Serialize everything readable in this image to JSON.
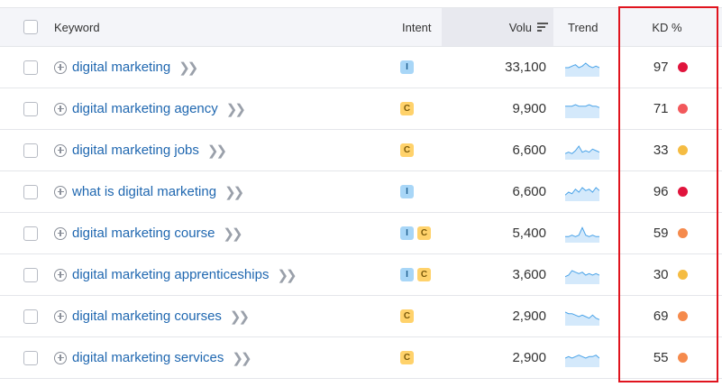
{
  "header": {
    "keyword_label": "Keyword",
    "intent_label": "Intent",
    "volume_label": "Volu",
    "trend_label": "Trend",
    "kd_label": "KD %"
  },
  "colors": {
    "kd_very_hard": "#e0143c",
    "kd_hard": "#f2585b",
    "kd_difficult": "#f58a4c",
    "kd_possible": "#f5bc42",
    "link": "#1f67b0",
    "highlight_box": "#e0141e"
  },
  "rows": [
    {
      "keyword": "digital marketing",
      "intent": [
        "I"
      ],
      "volume": "33,100",
      "kd": "97",
      "kd_color": "#e0143c",
      "trend": [
        6,
        6,
        7,
        8,
        6,
        7,
        9,
        7,
        6,
        7,
        6
      ]
    },
    {
      "keyword": "digital marketing agency",
      "intent": [
        "C"
      ],
      "volume": "9,900",
      "kd": "71",
      "kd_color": "#f2585b",
      "trend": [
        8,
        8,
        8,
        9,
        8,
        8,
        8,
        9,
        8,
        8,
        7
      ]
    },
    {
      "keyword": "digital marketing jobs",
      "intent": [
        "C"
      ],
      "volume": "6,600",
      "kd": "33",
      "kd_color": "#f5bc42",
      "trend": [
        4,
        5,
        4,
        6,
        9,
        5,
        6,
        5,
        7,
        6,
        5
      ]
    },
    {
      "keyword": "what is digital marketing",
      "intent": [
        "I"
      ],
      "volume": "6,600",
      "kd": "96",
      "kd_color": "#e0143c",
      "trend": [
        4,
        6,
        5,
        8,
        6,
        9,
        7,
        8,
        6,
        9,
        7
      ]
    },
    {
      "keyword": "digital marketing course",
      "intent": [
        "I",
        "C"
      ],
      "volume": "5,400",
      "kd": "59",
      "kd_color": "#f58a4c",
      "trend": [
        4,
        4,
        5,
        4,
        5,
        10,
        5,
        4,
        5,
        4,
        4
      ]
    },
    {
      "keyword": "digital marketing apprenticeships",
      "intent": [
        "I",
        "C"
      ],
      "volume": "3,600",
      "kd": "30",
      "kd_color": "#f5bc42",
      "trend": [
        5,
        6,
        9,
        8,
        7,
        8,
        6,
        7,
        6,
        7,
        6
      ]
    },
    {
      "keyword": "digital marketing courses",
      "intent": [
        "C"
      ],
      "volume": "2,900",
      "kd": "69",
      "kd_color": "#f58a4c",
      "trend": [
        9,
        8,
        8,
        7,
        6,
        7,
        6,
        5,
        7,
        5,
        4
      ]
    },
    {
      "keyword": "digital marketing services",
      "intent": [
        "C"
      ],
      "volume": "2,900",
      "kd": "55",
      "kd_color": "#f58a4c",
      "trend": [
        6,
        7,
        6,
        7,
        8,
        7,
        6,
        7,
        7,
        8,
        6
      ]
    }
  ]
}
